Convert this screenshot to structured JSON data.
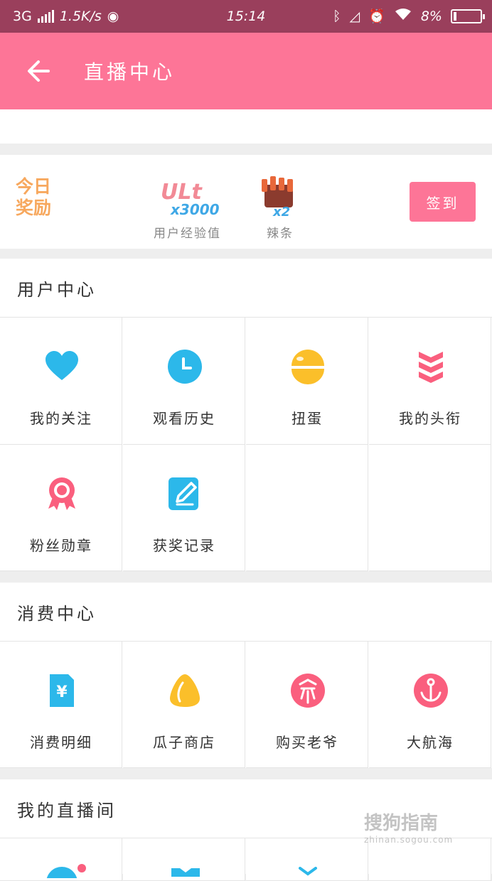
{
  "status_bar": {
    "network": "3G",
    "speed": "1.5K/s",
    "time": "15:14",
    "battery": "8%"
  },
  "app_bar": {
    "title": "直播中心"
  },
  "reward": {
    "today_line1": "今日",
    "today_line2": "奖励",
    "item1_badge": "ULt",
    "item1_count": "x3000",
    "item1_label": "用户经验值",
    "item2_count": "x2",
    "item2_label": "辣条",
    "sign_button": "签到"
  },
  "user_center": {
    "title": "用户中心",
    "items": [
      {
        "label": "我的关注",
        "icon": "heart-icon"
      },
      {
        "label": "观看历史",
        "icon": "clock-icon"
      },
      {
        "label": "扭蛋",
        "icon": "capsule-icon"
      },
      {
        "label": "我的头衔",
        "icon": "rank-icon"
      },
      {
        "label": "粉丝勋章",
        "icon": "medal-icon"
      },
      {
        "label": "获奖记录",
        "icon": "edit-icon"
      }
    ]
  },
  "consume_center": {
    "title": "消费中心",
    "items": [
      {
        "label": "消费明细",
        "icon": "yuan-icon"
      },
      {
        "label": "瓜子商店",
        "icon": "seed-icon"
      },
      {
        "label": "购买老爷",
        "icon": "lord-icon"
      },
      {
        "label": "大航海",
        "icon": "anchor-icon"
      }
    ]
  },
  "my_room": {
    "title": "我的直播间"
  },
  "watermark": {
    "brand": "搜狗指南",
    "url": "zhinan.sogou.com"
  },
  "colors": {
    "accent": "#fd7597",
    "status_bar": "#9a3f5c",
    "blue": "#2cb8ea",
    "yellow": "#fbbf2a",
    "pink": "#fa5f7e"
  }
}
